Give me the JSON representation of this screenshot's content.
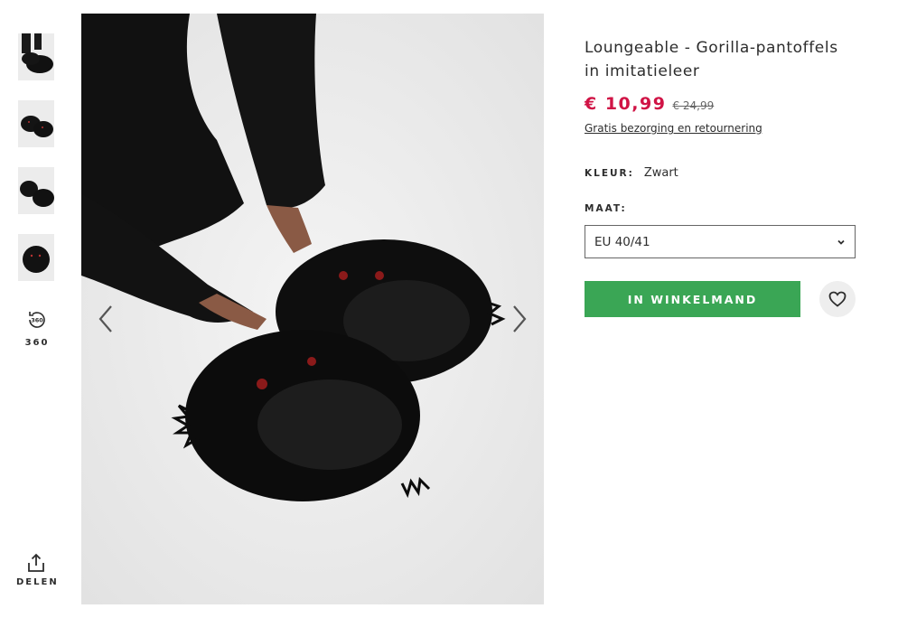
{
  "gallery": {
    "thumbnails": [
      {
        "alt": "thumbnail-1"
      },
      {
        "alt": "thumbnail-2"
      },
      {
        "alt": "thumbnail-3"
      },
      {
        "alt": "thumbnail-4"
      }
    ],
    "view360_label": "360",
    "view360_icon": "rotate-360-icon",
    "share_label": "DELEN",
    "share_icon": "share-icon",
    "prev_icon": "chevron-left-icon",
    "next_icon": "chevron-right-icon"
  },
  "product": {
    "title": "Loungeable - Gorilla-pantoffels in imitatieleer",
    "price_now": "€ 10,99",
    "price_was": "€ 24,99",
    "shipping_link": "Gratis bezorging en retournering",
    "color_label": "KLEUR:",
    "color_value": "Zwart",
    "size_label": "MAAT:",
    "size_value": "EU 40/41",
    "add_to_bag_label": "IN WINKELMAND",
    "wishlist_icon": "heart-icon"
  },
  "colors": {
    "sale_price": "#d01345",
    "add_button": "#3aa655",
    "text": "#2d2d2d"
  }
}
